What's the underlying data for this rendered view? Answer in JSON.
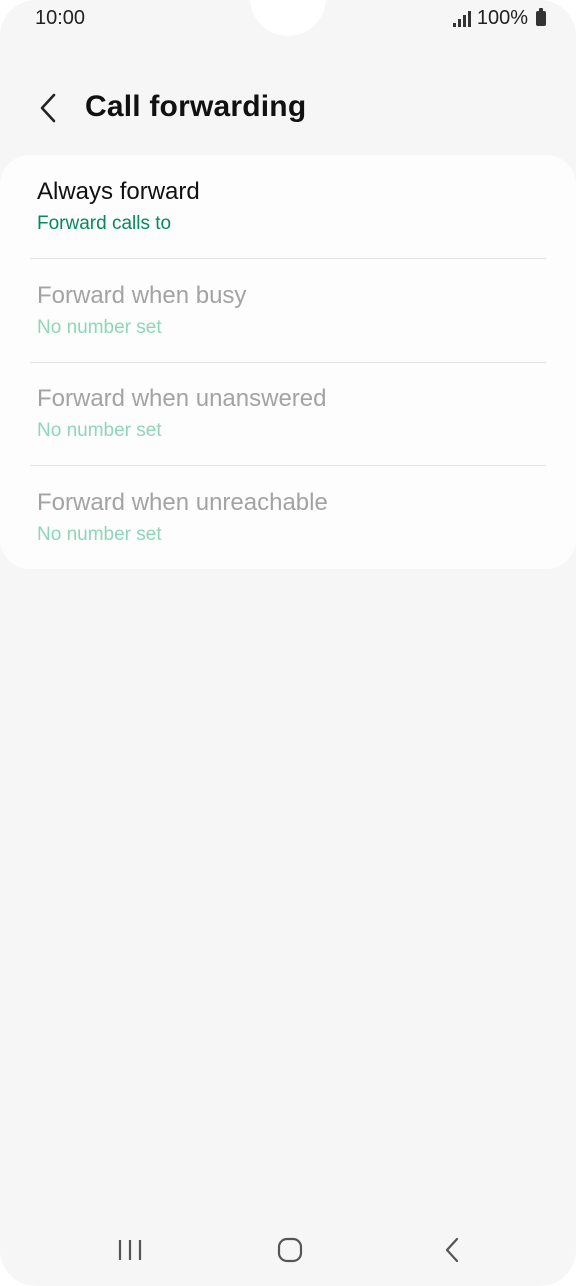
{
  "status_bar": {
    "time": "10:00",
    "battery_text": "100%",
    "signal_icon": "signal-icon",
    "battery_icon": "battery-icon"
  },
  "header": {
    "title": "Call forwarding",
    "back_icon": "chevron-left-icon"
  },
  "options": [
    {
      "title": "Always forward",
      "subtitle": "Forward calls to",
      "enabled": true
    },
    {
      "title": "Forward when busy",
      "subtitle": "No number set",
      "enabled": false
    },
    {
      "title": "Forward when unanswered",
      "subtitle": "No number set",
      "enabled": false
    },
    {
      "title": "Forward when unreachable",
      "subtitle": "No number set",
      "enabled": false
    }
  ],
  "nav_bar": {
    "recents_icon": "recent-apps-icon",
    "home_icon": "home-icon",
    "back_icon": "back-icon"
  },
  "colors": {
    "accent": "#078a5b",
    "accent_disabled": "#8ed6ba",
    "background": "#f6f6f6",
    "card": "#fdfdfd"
  }
}
